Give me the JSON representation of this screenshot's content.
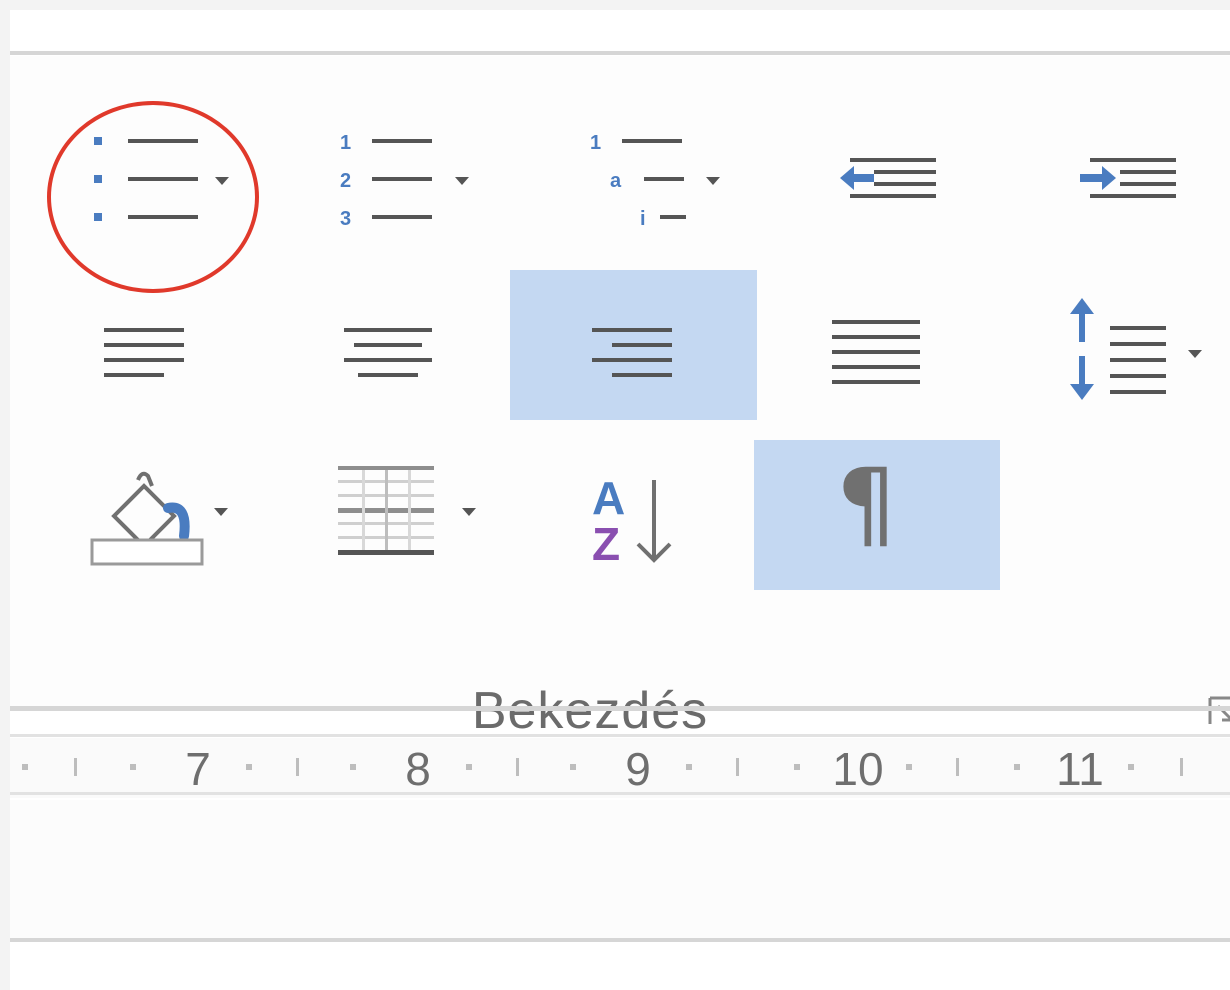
{
  "group": {
    "label": "Bekezdés"
  },
  "buttons": {
    "bullets": {
      "icon": "bulleted-list-icon",
      "has_dropdown": true,
      "circled": true
    },
    "numbering": {
      "icon": "numbered-list-icon",
      "has_dropdown": true,
      "number_labels": [
        "1",
        "2",
        "3"
      ]
    },
    "multilevel": {
      "icon": "multilevel-list-icon",
      "has_dropdown": true,
      "level_labels": [
        "1",
        "a",
        "i"
      ]
    },
    "decrease_indent": {
      "icon": "decrease-indent-icon"
    },
    "increase_indent": {
      "icon": "increase-indent-icon"
    },
    "align_left": {
      "icon": "align-left-icon"
    },
    "align_center": {
      "icon": "align-center-icon"
    },
    "align_right": {
      "icon": "align-right-icon",
      "active": true
    },
    "justify": {
      "icon": "justify-icon"
    },
    "line_spacing": {
      "icon": "line-spacing-icon",
      "has_dropdown": true
    },
    "shading": {
      "icon": "paint-bucket-icon",
      "has_dropdown": true
    },
    "borders": {
      "icon": "borders-icon",
      "has_dropdown": true
    },
    "sort": {
      "icon": "sort-az-icon",
      "letters": [
        "A",
        "Z"
      ]
    },
    "show_marks": {
      "icon": "pilcrow-icon",
      "glyph": "¶",
      "active": true
    }
  },
  "ruler": {
    "numbers": [
      "7",
      "8",
      "9",
      "10",
      "11"
    ]
  },
  "colors": {
    "accent_blue": "#4a7cc0",
    "active_bg": "#c4d8f2",
    "highlight_ring": "#e0392b",
    "sort_z_purple": "#8a4fb0"
  }
}
